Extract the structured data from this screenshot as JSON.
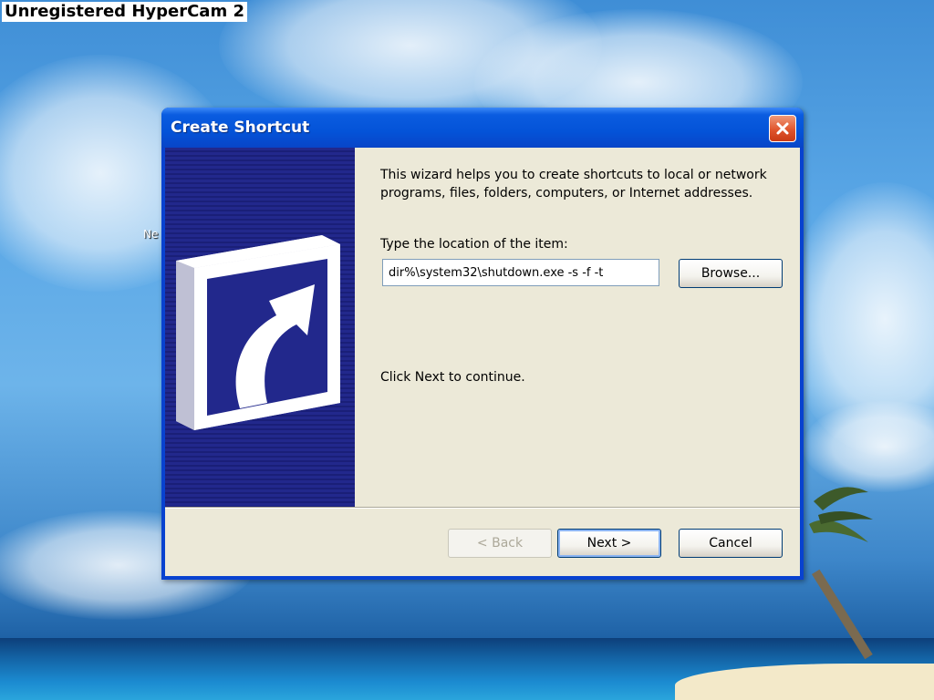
{
  "watermark": "Unregistered HyperCam 2",
  "desktop": {
    "partial_label": "Ne"
  },
  "dialog": {
    "title": "Create Shortcut",
    "close_icon": "close-icon",
    "intro_text": "This wizard helps you to create shortcuts to local or network programs, files, folders, computers, or Internet addresses.",
    "location_label": "Type the location of the item:",
    "location_value": "dir%\\system32\\shutdown.exe -s -f -t",
    "browse_label": "Browse...",
    "continue_text": "Click Next to continue.",
    "back_label": "< Back",
    "next_label": "Next >",
    "cancel_label": "Cancel",
    "banner_icon": "shortcut-arrow-icon"
  },
  "colors": {
    "titlebar": "#0453d8",
    "banner": "#22288c",
    "dialog_face": "#ece9d8",
    "close_button": "#e0552d"
  }
}
